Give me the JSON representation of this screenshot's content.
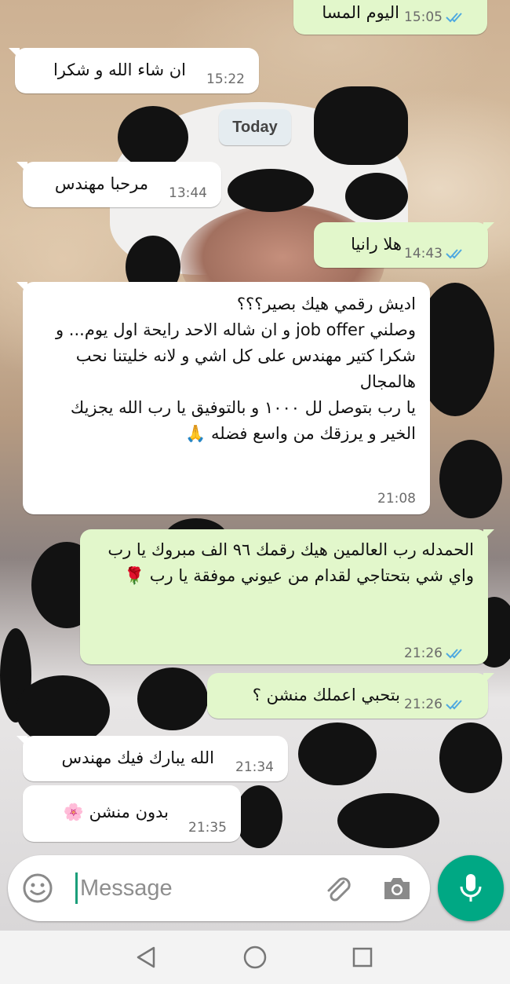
{
  "messages": [
    {
      "id": "m0",
      "direction": "out",
      "text": "اليوم المسا",
      "time": "15:05",
      "read": true
    },
    {
      "id": "m1",
      "direction": "in",
      "text": "ان شاء الله و شكرا",
      "time": "15:22"
    },
    {
      "id": "m2",
      "direction": "in",
      "text": "مرحبا مهندس",
      "time": "13:44"
    },
    {
      "id": "m3",
      "direction": "out",
      "text": "هلا رانيا",
      "time": "14:43",
      "read": true
    },
    {
      "id": "m4",
      "direction": "in",
      "text": "اديش رقمي هيك بصير؟؟؟\nوصلني job offer و ان شاله الاحد رايحة اول يوم... و شكرا كتير مهندس على كل اشي و لانه خليتنا نحب هالمجال\nيا رب بتوصل لل ١٠٠٠ و بالتوفيق يا رب الله يجزيك الخير و يرزقك من واسع فضله 🙏",
      "time": "21:08"
    },
    {
      "id": "m5",
      "direction": "out",
      "text": "الحمدله رب العالمين هيك رقمك ٩٦ الف مبروك يا رب واي شي بتحتاجي لقدام من عيوني موفقة يا رب 🌹",
      "time": "21:26",
      "read": true
    },
    {
      "id": "m6",
      "direction": "out",
      "text": "بتحبي اعملك منشن ؟",
      "time": "21:26",
      "read": true
    },
    {
      "id": "m7",
      "direction": "in",
      "text": "الله يبارك فيك مهندس",
      "time": "21:34"
    },
    {
      "id": "m8",
      "direction": "in",
      "text": "بدون منشن 🌸",
      "time": "21:35"
    }
  ],
  "date_divider": "Today",
  "composer": {
    "placeholder": "Message"
  },
  "icons": {
    "emoji": "smiley-icon",
    "attach": "paperclip-icon",
    "camera": "camera-icon",
    "mic": "microphone-icon",
    "read": "double-check-icon",
    "back": "back-triangle-icon",
    "home": "home-circle-icon",
    "recents": "recents-square-icon"
  },
  "colors": {
    "incoming": "#ffffff",
    "outgoing": "#e2f7cb",
    "tick": "#4fa9e0",
    "accent": "#00a884"
  }
}
